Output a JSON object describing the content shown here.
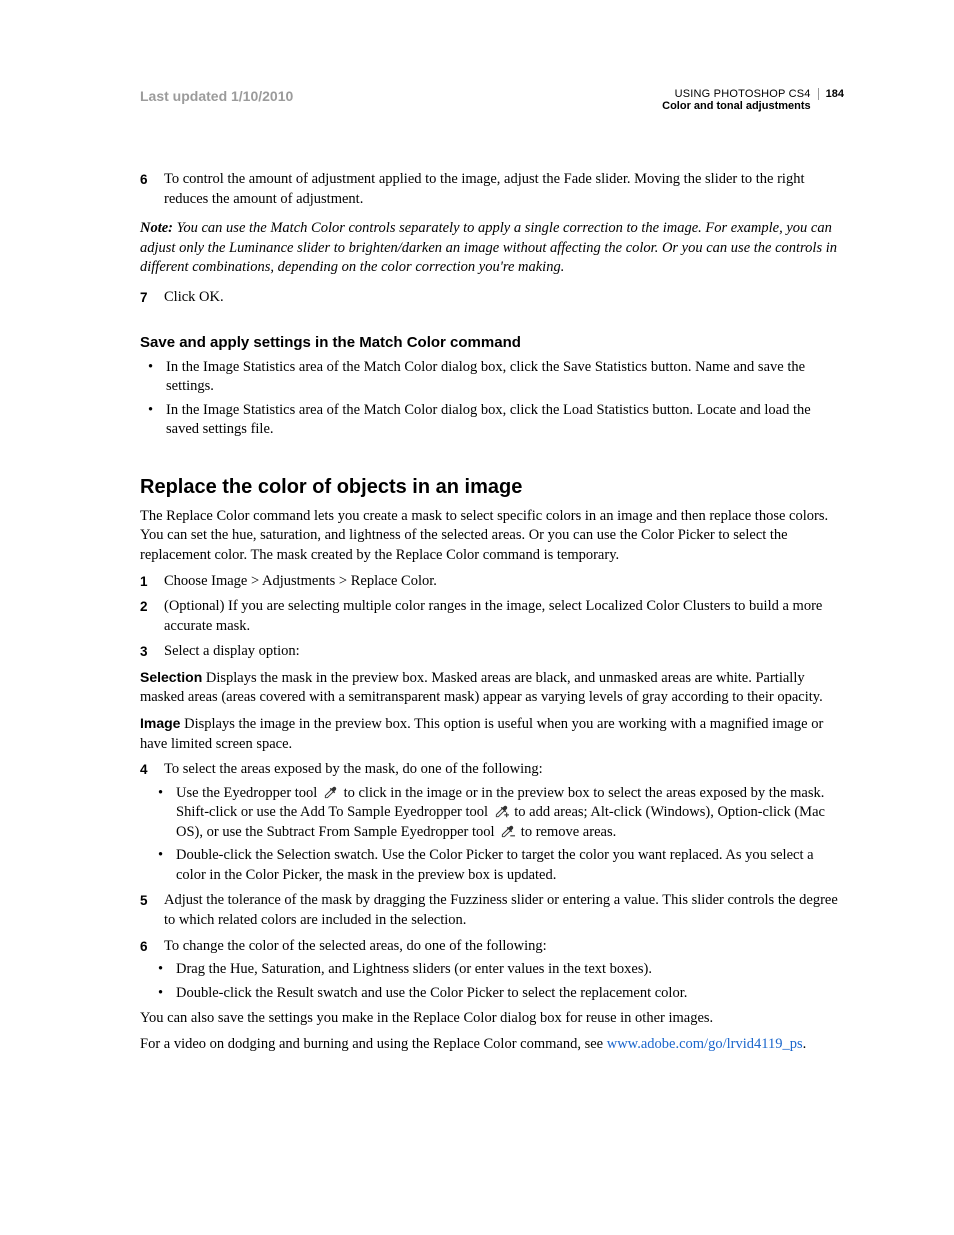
{
  "header": {
    "last_updated": "Last updated 1/10/2010",
    "doc_title": "USING PHOTOSHOP CS4",
    "chapter": "Color and tonal adjustments",
    "page_number": "184"
  },
  "steps_top": {
    "s6_num": "6",
    "s6_text": "To control the amount of adjustment applied to the image, adjust the Fade slider. Moving the slider to the right reduces the amount of adjustment.",
    "note_label": "Note:",
    "note_text": " You can use the Match Color controls separately to apply a single correction to the image. For example, you can adjust only the Luminance slider to brighten/darken an image without affecting the color. Or you can use the controls in different combinations, depending on the color correction you're making.",
    "s7_num": "7",
    "s7_text": "Click OK."
  },
  "save_section": {
    "heading": "Save and apply settings in the Match Color command",
    "b1": "In the Image Statistics area of the Match Color dialog box, click the Save Statistics button. Name and save the settings.",
    "b2": "In the Image Statistics area of the Match Color dialog box, click the Load Statistics button. Locate and load the saved settings file."
  },
  "replace_section": {
    "heading": "Replace the color of objects in an image",
    "intro": "The Replace Color command lets you create a mask to select specific colors in an image and then replace those colors. You can set the hue, saturation, and lightness of the selected areas. Or you can use the Color Picker to select the replacement color. The mask created by the Replace Color command is temporary.",
    "s1_num": "1",
    "s1_text": "Choose Image > Adjustments > Replace Color.",
    "s2_num": "2",
    "s2_text": "(Optional) If you are selecting multiple color ranges in the image, select Localized Color Clusters to build a more accurate mask.",
    "s3_num": "3",
    "s3_text": "Select a display option:",
    "def_selection_label": "Selection",
    "def_selection_text": "  Displays the mask in the preview box. Masked areas are black, and unmasked areas are white. Partially masked areas (areas covered with a semitransparent mask) appear as varying levels of gray according to their opacity.",
    "def_image_label": "Image",
    "def_image_text": "  Displays the image in the preview box. This option is useful when you are working with a magnified image or have limited screen space.",
    "s4_num": "4",
    "s4_text": "To select the areas exposed by the mask, do one of the following:",
    "b4a_pre": "Use the Eyedropper tool ",
    "b4a_mid1": " to click in the image or in the preview box to select the areas exposed by the mask. Shift-click or use the Add To Sample Eyedropper tool ",
    "b4a_mid2": " to add areas; Alt-click (Windows), Option-click (Mac OS), or use the Subtract From Sample Eyedropper tool ",
    "b4a_end": " to remove areas.",
    "b4b": "Double-click the Selection swatch. Use the Color Picker to target the color you want replaced. As you select a color in the Color Picker, the mask in the preview box is updated.",
    "s5_num": "5",
    "s5_text": "Adjust the tolerance of the mask by dragging the Fuzziness slider or entering a value. This slider controls the degree to which related colors are included in the selection.",
    "s6_num": "6",
    "s6_text": "To change the color of the selected areas, do one of the following:",
    "b6a": "Drag the Hue, Saturation, and Lightness sliders (or enter values in the text boxes).",
    "b6b": "Double-click the Result swatch and use the Color Picker to select the replacement color.",
    "outro1": "You can also save the settings you make in the Replace Color dialog box for reuse in other images.",
    "outro2_pre": "For a video on dodging and burning and using the Replace Color command, see ",
    "outro2_link": "www.adobe.com/go/lrvid4119_ps",
    "outro2_post": "."
  }
}
